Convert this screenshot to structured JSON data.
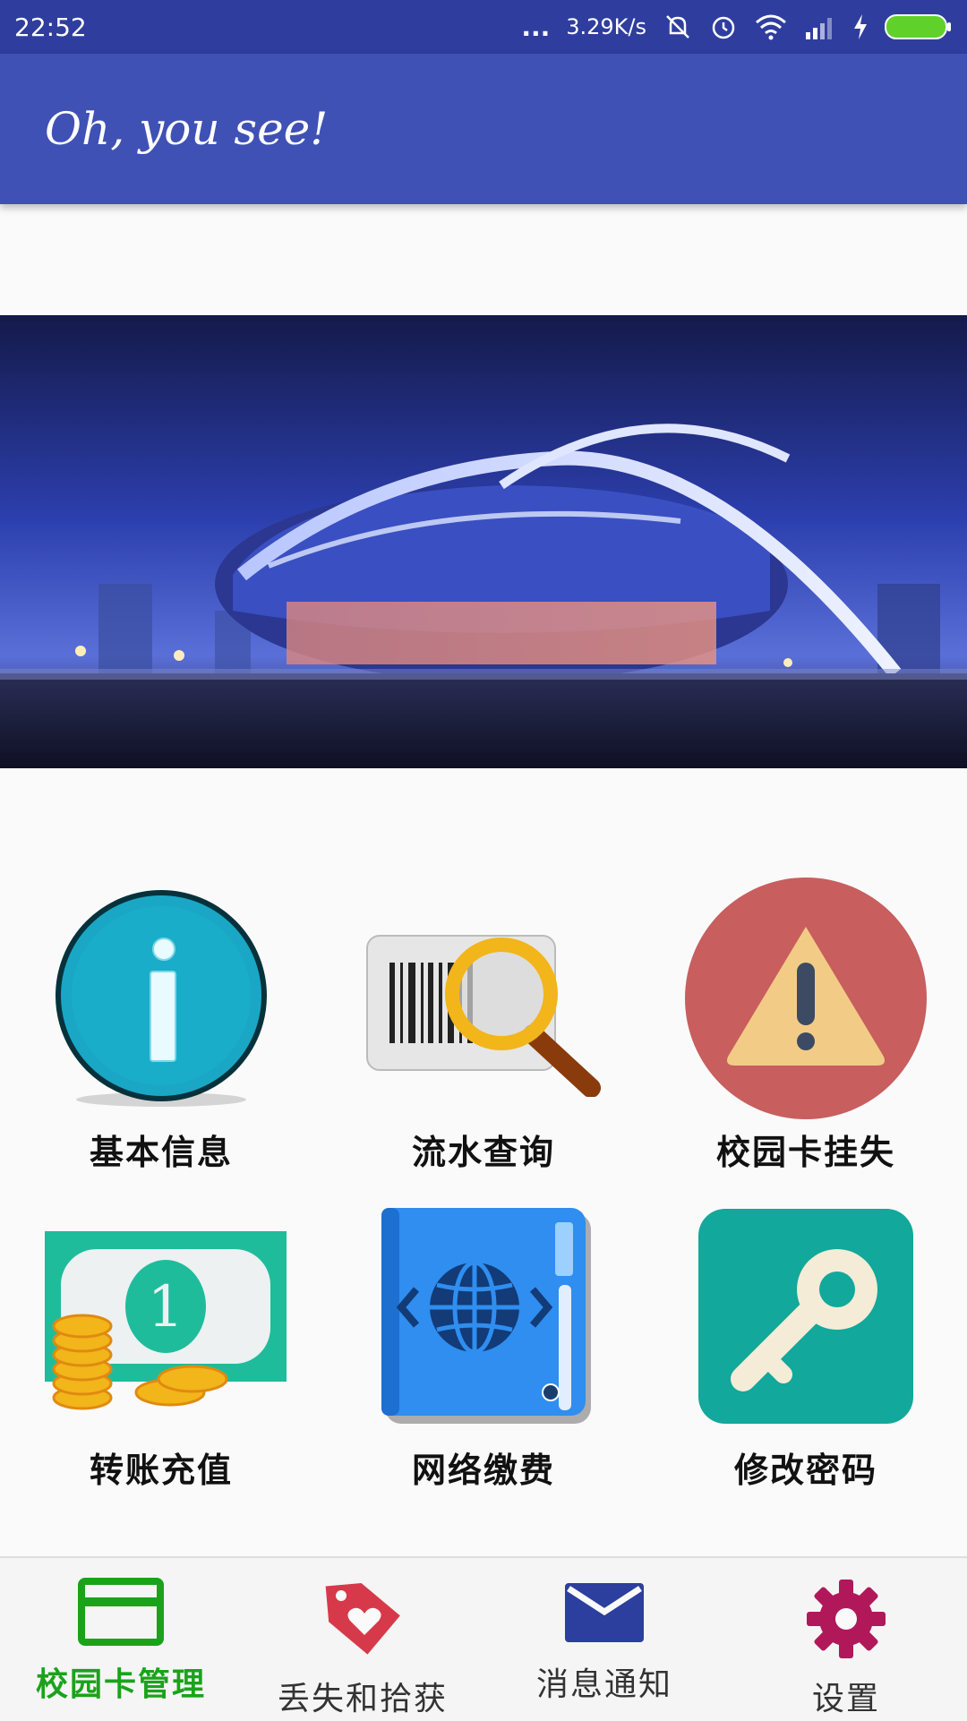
{
  "status_bar": {
    "time": "22:52",
    "dots": "...",
    "speed": "3.29K/s",
    "icons": [
      "mute-icon",
      "alarm-icon",
      "wifi-icon",
      "signal-icon",
      "charging-icon",
      "battery-icon"
    ]
  },
  "app_bar": {
    "title": "Oh, you see!"
  },
  "banner": {
    "image": "stadium-night-photo"
  },
  "grid": {
    "items": [
      {
        "label": "基本信息",
        "icon": "info-icon"
      },
      {
        "label": "流水查询",
        "icon": "barcode-search-icon"
      },
      {
        "label": "校园卡挂失",
        "icon": "warning-icon"
      },
      {
        "label": "转账充值",
        "icon": "money-coins-icon"
      },
      {
        "label": "网络缴费",
        "icon": "web-book-icon"
      },
      {
        "label": "修改密码",
        "icon": "key-icon"
      }
    ]
  },
  "bottom_nav": {
    "items": [
      {
        "label": "校园卡管理",
        "icon": "card-icon",
        "active": true
      },
      {
        "label": "丢失和拾获",
        "icon": "tag-heart-icon",
        "active": false
      },
      {
        "label": "消息通知",
        "icon": "mail-icon",
        "active": false
      },
      {
        "label": "设置",
        "icon": "gear-icon",
        "active": false
      }
    ]
  },
  "colors": {
    "status_bar": "#2f3e9e",
    "app_bar": "#3f51b5",
    "active_nav": "#1aa31a",
    "card_icon": "#1aa31a",
    "tag_icon": "#d63a4a",
    "mail_icon": "#2c3e9e",
    "gear_icon": "#b0185a"
  }
}
